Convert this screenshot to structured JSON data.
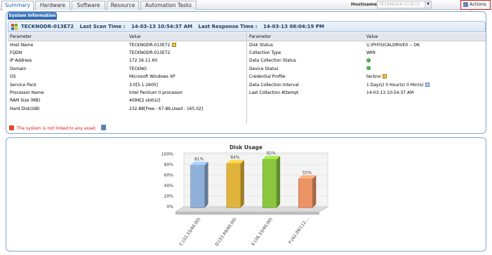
{
  "tabs": [
    {
      "label": "Summary",
      "active": true
    },
    {
      "label": "Hardware",
      "active": false
    },
    {
      "label": "Software",
      "active": false
    },
    {
      "label": "Resource",
      "active": false
    },
    {
      "label": "Automation Tasks",
      "active": false
    }
  ],
  "host": {
    "label": "Hostname IP",
    "value": "TECKNODR-013E72"
  },
  "actions_label": "Actions",
  "system_info": {
    "tab_label": "System Information",
    "host_name": "TECKNODR-013E72",
    "last_scan_label": "Last Scan Time :",
    "last_scan_value": "14-03-13 10:54:37 AM",
    "last_response_label": "Last Response Time :",
    "last_response_value": "14-03-13 06:04:19 PM"
  },
  "left_table": {
    "headers": [
      "Parameter",
      "Value"
    ],
    "rows": [
      [
        "Host Name",
        "TECKNODR-013E72"
      ],
      [
        "FQDN",
        "TECKNODR-013E72"
      ],
      [
        "IP Address",
        "172.16.11.60"
      ],
      [
        "Domain",
        "TECKNO"
      ],
      [
        "OS",
        "Microsoft Windows XP"
      ],
      [
        "Service Pack",
        "3.0[5.1.2600]"
      ],
      [
        "Processor Name",
        "Intel Pentium II processor"
      ],
      [
        "RAM Size (MB)",
        "4096[2 slot(s)]"
      ],
      [
        "Hard Disk(GB)",
        "232.88[Free : 67.86,Used : 165.02]"
      ]
    ]
  },
  "right_table": {
    "headers": [
      "Parameter",
      "Value"
    ],
    "rows": [
      [
        "Disk Status",
        "\\\\.\\PHYSICALDRIVE0 -- OK"
      ],
      [
        "Collection Type",
        "WMI"
      ],
      [
        "Data Collection Status",
        ""
      ],
      [
        "Device Status",
        ""
      ],
      [
        "Credential Profile",
        "teckno"
      ],
      [
        "Data Collection Interval",
        "1 Day(s) 0 Hour(s) 0 Min(s)"
      ],
      [
        "Last Collection Attempt",
        "14-03-13 10:54:37 AM"
      ]
    ]
  },
  "notice": "The system is not linked to any asset.",
  "chart_data": {
    "type": "bar",
    "title": "Disk Usage",
    "categories": [
      "C:(33.33/40.00)",
      "D:(33.49/40.00)",
      "E:(36.33/40.00)",
      "F:(62.09/112..."
    ],
    "values": [
      81,
      84,
      92,
      55
    ],
    "value_labels": [
      "81%",
      "84%",
      "92%",
      "55%"
    ],
    "ylim": [
      0,
      100
    ],
    "yticks": [
      "0%",
      "20%",
      "40%",
      "60%",
      "80%",
      "100%"
    ],
    "colors": [
      "#8fb0d8",
      "#e2b33a",
      "#8cc63f",
      "#ec9366"
    ]
  }
}
